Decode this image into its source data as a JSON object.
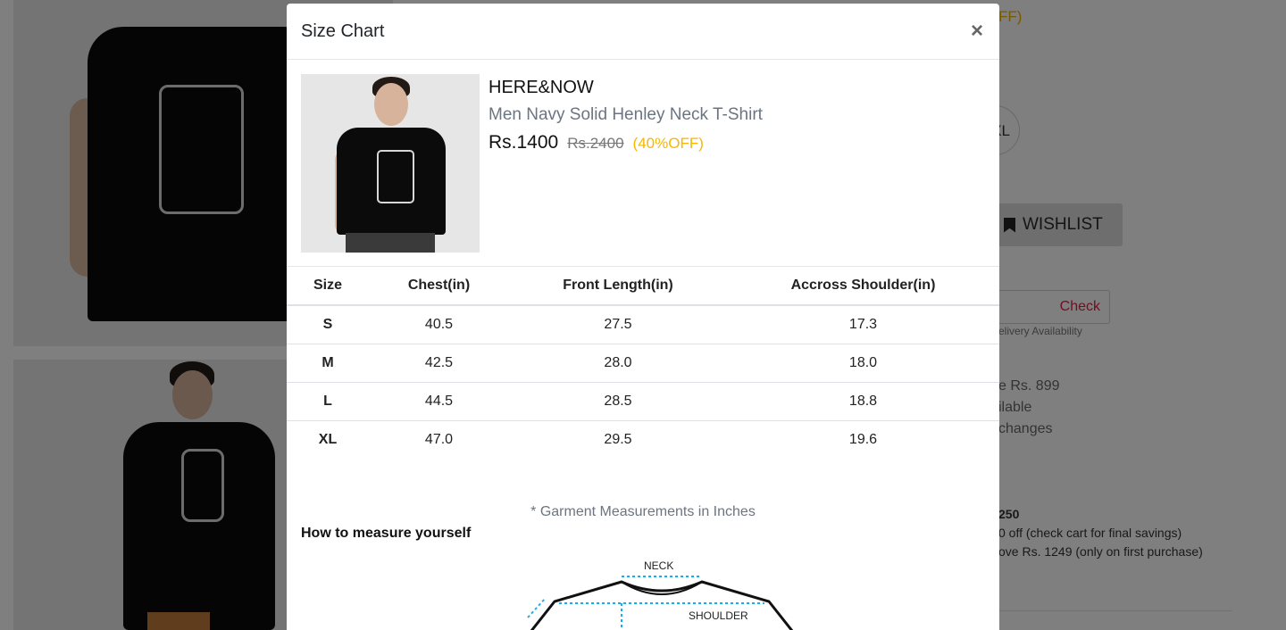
{
  "background": {
    "discount_fragment": "FF)",
    "size_fragment": "XL",
    "wishlist_label": "WISHLIST",
    "check_label": "Check",
    "delivery_fragment": "elivery Availability",
    "info_lines": [
      "e Rs. 899",
      "ilable",
      "changes"
    ],
    "offer_lines": [
      "250",
      "0 off (check cart for final savings)",
      "ove Rs. 1249 (only on first purchase)"
    ]
  },
  "modal": {
    "title": "Size Chart",
    "close_label": "×",
    "product": {
      "brand": "HERE&NOW",
      "name": "Men Navy Solid Henley Neck T-Shirt",
      "price": "Rs.1400",
      "mrp": "Rs.2400",
      "discount": "(40%OFF)"
    },
    "table": {
      "headers": [
        "Size",
        "Chest(in)",
        "Front Length(in)",
        "Accross Shoulder(in)"
      ],
      "rows": [
        [
          "S",
          "40.5",
          "27.5",
          "17.3"
        ],
        [
          "M",
          "42.5",
          "28.0",
          "18.0"
        ],
        [
          "L",
          "44.5",
          "28.5",
          "18.8"
        ],
        [
          "XL",
          "47.0",
          "29.5",
          "19.6"
        ]
      ]
    },
    "note": "* Garment Measurements in Inches",
    "how_to_title": "How to measure yourself",
    "diagram_labels": {
      "neck": "NECK",
      "shoulder": "SHOULDER"
    }
  }
}
